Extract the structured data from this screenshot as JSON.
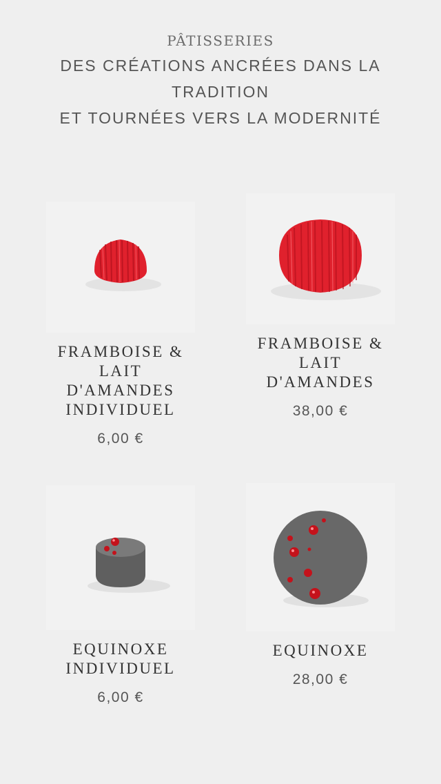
{
  "header": {
    "kicker": "PÂTISSERIES",
    "headline_line1": "DES CRÉATIONS ANCRÉES DANS LA TRADITION",
    "headline_line2": "ET TOURNÉES VERS LA MODERNITÉ"
  },
  "products": [
    {
      "name": "FRAMBOISE & LAIT D'AMANDES INDIVIDUEL",
      "price": "6,00 €"
    },
    {
      "name": "FRAMBOISE & LAIT D'AMANDES",
      "price": "38,00 €"
    },
    {
      "name": "EQUINOXE INDIVIDUEL",
      "price": "6,00 €"
    },
    {
      "name": "EQUINOXE",
      "price": "28,00 €"
    }
  ],
  "colors": {
    "background": "#efefef",
    "raspberry": "#e0212d",
    "equinoxe_grey": "#6a6a6a"
  }
}
